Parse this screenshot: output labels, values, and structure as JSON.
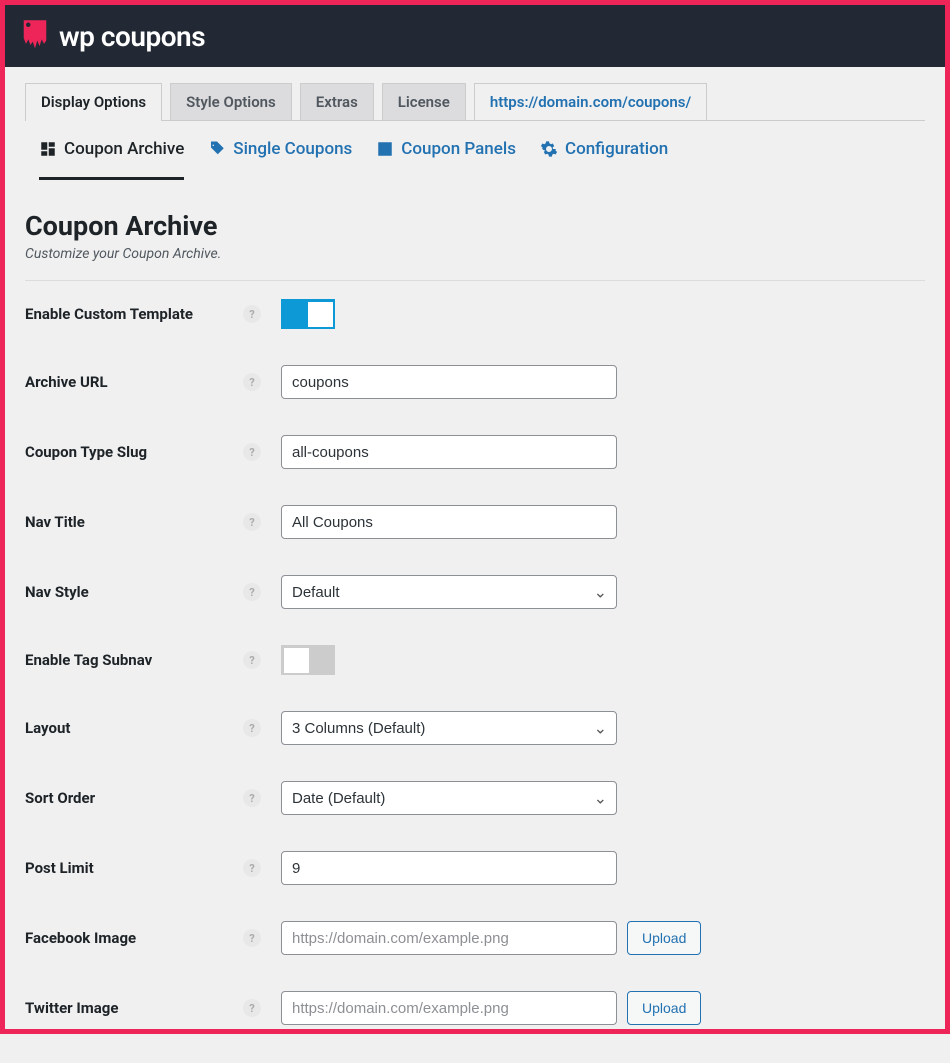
{
  "header": {
    "title": "wp coupons"
  },
  "tabs": {
    "display": "Display Options",
    "style": "Style Options",
    "extras": "Extras",
    "license": "License",
    "link": "https://domain.com/coupons/"
  },
  "subtabs": {
    "archive": "Coupon Archive",
    "single": "Single Coupons",
    "panels": "Coupon Panels",
    "config": "Configuration"
  },
  "section": {
    "title": "Coupon Archive",
    "desc": "Customize your Coupon Archive."
  },
  "fields": {
    "enable_custom_template": {
      "label": "Enable Custom Template"
    },
    "archive_url": {
      "label": "Archive URL",
      "value": "coupons"
    },
    "coupon_type_slug": {
      "label": "Coupon Type Slug",
      "value": "all-coupons"
    },
    "nav_title": {
      "label": "Nav Title",
      "value": "All Coupons"
    },
    "nav_style": {
      "label": "Nav Style",
      "value": "Default"
    },
    "enable_tag_subnav": {
      "label": "Enable Tag Subnav"
    },
    "layout": {
      "label": "Layout",
      "value": "3 Columns (Default)"
    },
    "sort_order": {
      "label": "Sort Order",
      "value": "Date (Default)"
    },
    "post_limit": {
      "label": "Post Limit",
      "value": "9"
    },
    "facebook_image": {
      "label": "Facebook Image",
      "placeholder": "https://domain.com/example.png",
      "button": "Upload"
    },
    "twitter_image": {
      "label": "Twitter Image",
      "placeholder": "https://domain.com/example.png",
      "button": "Upload"
    }
  },
  "help": "?"
}
